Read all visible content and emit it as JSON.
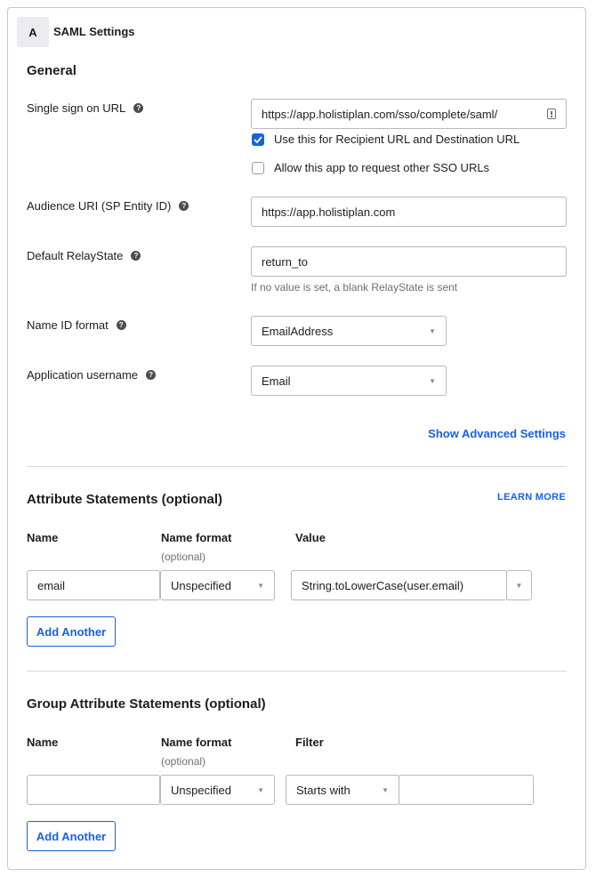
{
  "card": {
    "step": "A",
    "title": "SAML Settings"
  },
  "general": {
    "heading": "General",
    "sso_url": {
      "label": "Single sign on URL",
      "value": "https://app.holistiplan.com/sso/complete/saml/",
      "checkbox_recipient": {
        "label": "Use this for Recipient URL and Destination URL",
        "checked": true
      },
      "checkbox_other": {
        "label": "Allow this app to request other SSO URLs",
        "checked": false
      }
    },
    "audience_uri": {
      "label": "Audience URI (SP Entity ID)",
      "value": "https://app.holistiplan.com"
    },
    "relay_state": {
      "label": "Default RelayState",
      "value": "return_to",
      "hint": "If no value is set, a blank RelayState is sent"
    },
    "name_id_format": {
      "label": "Name ID format",
      "value": "EmailAddress"
    },
    "app_username": {
      "label": "Application username",
      "value": "Email"
    },
    "advanced_link": "Show Advanced Settings"
  },
  "attribute_statements": {
    "heading": "Attribute Statements (optional)",
    "learn_more": "LEARN MORE",
    "columns": {
      "name": "Name",
      "name_format": "Name format",
      "name_format_sub": "(optional)",
      "value": "Value"
    },
    "row": {
      "name": "email",
      "name_format": "Unspecified",
      "value": "String.toLowerCase(user.email)"
    },
    "add_button": "Add Another"
  },
  "group_attribute_statements": {
    "heading": "Group Attribute Statements (optional)",
    "columns": {
      "name": "Name",
      "name_format": "Name format",
      "name_format_sub": "(optional)",
      "filter": "Filter"
    },
    "row": {
      "name": "",
      "name_format": "Unspecified",
      "filter_type": "Starts with",
      "filter_value": ""
    },
    "add_button": "Add Another"
  },
  "icons": {
    "help": "help-circle-icon",
    "caret": "chevron-down-icon",
    "check": "check-icon",
    "url_field": "info-card-icon"
  },
  "colors": {
    "accent": "#1662dd",
    "border": "#b8b8be",
    "muted_text": "#6e6e78"
  }
}
